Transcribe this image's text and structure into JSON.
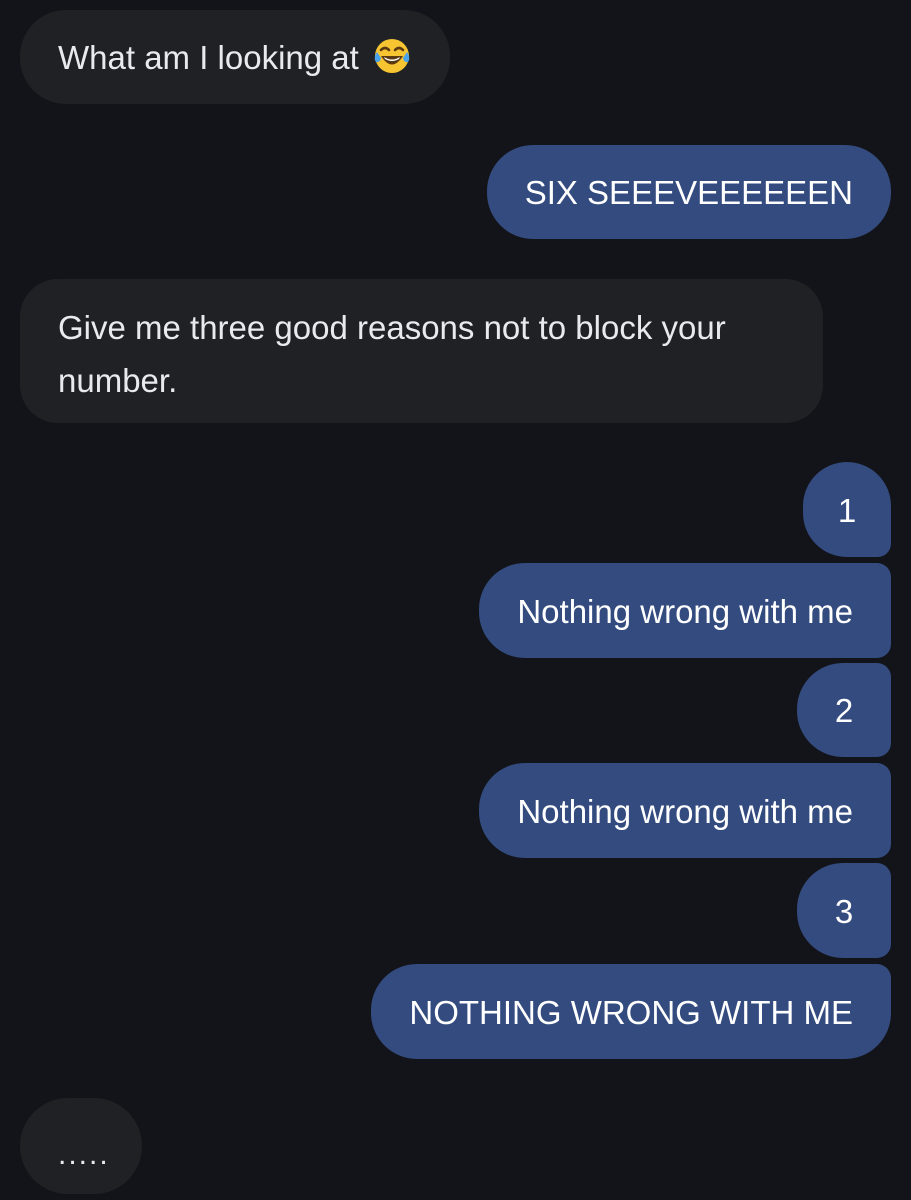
{
  "messages": [
    {
      "direction": "incoming",
      "text": "What am I looking at",
      "emoji": "face-with-tears-of-joy"
    },
    {
      "direction": "outgoing",
      "text": "SIX SEEEVEEEEEEN"
    },
    {
      "direction": "incoming",
      "text": "Give me three good reasons not to block your number."
    },
    {
      "direction": "outgoing",
      "text": "1"
    },
    {
      "direction": "outgoing",
      "text": "Nothing wrong with me"
    },
    {
      "direction": "outgoing",
      "text": "2"
    },
    {
      "direction": "outgoing",
      "text": "Nothing wrong with me"
    },
    {
      "direction": "outgoing",
      "text": "3"
    },
    {
      "direction": "outgoing",
      "text": "NOTHING WRONG WITH ME"
    },
    {
      "direction": "incoming",
      "text": "....."
    }
  ],
  "colors": {
    "background": "#131419",
    "incoming_bubble": "#202125",
    "outgoing_bubble": "#334b7f",
    "text": "#ffffff"
  }
}
